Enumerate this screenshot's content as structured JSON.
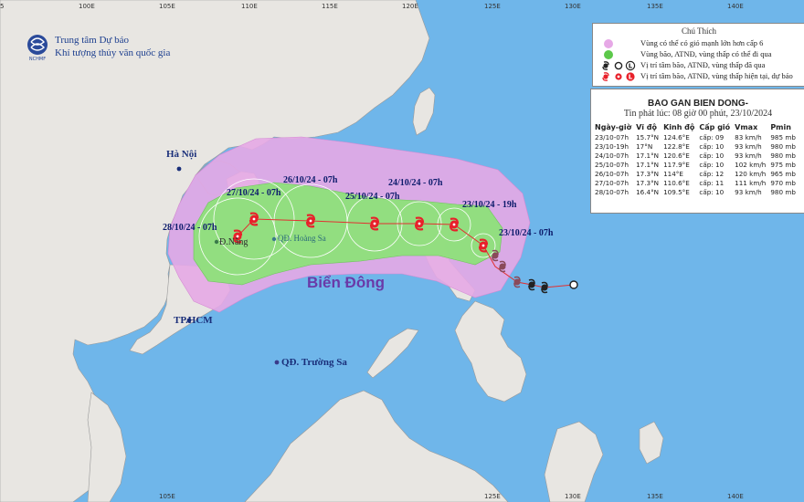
{
  "agency": {
    "line1": "Trung tâm Dự báo",
    "line2": "Khí tượng thủy văn quốc gia",
    "logo_text": "NCHMF"
  },
  "legend": {
    "title": "Chú Thích",
    "items": [
      {
        "symbol": "pink-dot",
        "text": "Vùng có thể có gió mạnh lớn hơn cấp 6"
      },
      {
        "symbol": "green-dot",
        "text": "Vùng bão, ATNĐ, vùng thấp có thể đi qua"
      },
      {
        "symbol": "past-symbols",
        "text": "Vị trí tâm bão, ATNĐ, vùng thấp đã qua",
        "glyph": "L"
      },
      {
        "symbol": "current-symbols",
        "text": "Vị trí tâm bão, ATNĐ, vùng thấp hiện tại, dự báo",
        "glyph": "L"
      }
    ]
  },
  "info": {
    "title": "BAO GAN BIEN DONG-",
    "issued": "Tin phát lúc: 08 giờ 00 phút, 23/10/2024",
    "columns": [
      "Ngày-giờ",
      "Vĩ độ",
      "Kinh độ",
      "Cấp gió",
      "Vmax",
      "Pmin"
    ],
    "rows": [
      [
        "23/10-07h",
        "15.7°N",
        "124.6°E",
        "cấp: 09",
        "83 km/h",
        "985 mb"
      ],
      [
        "23/10-19h",
        "17°N",
        "122.8°E",
        "cấp: 10",
        "93 km/h",
        "980 mb"
      ],
      [
        "24/10-07h",
        "17.1°N",
        "120.6°E",
        "cấp: 10",
        "93 km/h",
        "980 mb"
      ],
      [
        "25/10-07h",
        "17.1°N",
        "117.9°E",
        "cấp: 10",
        "102 km/h",
        "975 mb"
      ],
      [
        "26/10-07h",
        "17.3°N",
        "114°E",
        "cấp: 12",
        "120 km/h",
        "965 mb"
      ],
      [
        "27/10-07h",
        "17.3°N",
        "110.6°E",
        "cấp: 11",
        "111 km/h",
        "970 mb"
      ],
      [
        "28/10-07h",
        "16.4°N",
        "109.5°E",
        "cấp: 10",
        "93 km/h",
        "980 mb"
      ]
    ]
  },
  "map": {
    "sea_name": "Biển Đông",
    "places": {
      "hanoi": "Hà Nội",
      "danang": "Đ.Nẵng",
      "hoangsa": "QĐ. Hoàng Sa",
      "hcm": "TP.HCM",
      "truongsa": "QĐ. Trường Sa"
    },
    "forecast_dates": {
      "d2310_07": "23/10/24 - 07h",
      "d2310_19": "23/10/24 - 19h",
      "d2410": "24/10/24 - 07h",
      "d2510": "25/10/24 - 07h",
      "d2610": "26/10/24 - 07h",
      "d2710": "27/10/24 - 07h",
      "d2810": "28/10/24 - 07h"
    },
    "lon_ticks": [
      "100E",
      "105E",
      "110E",
      "115E",
      "120E",
      "125E",
      "130E",
      "135E",
      "140E"
    ],
    "lat_ticks_left": [
      "5"
    ],
    "colors": {
      "sea": "#6fb6ea",
      "land": "#e8e6e2",
      "pink_zone": "#e6a8e6",
      "green_zone": "#8ee07a",
      "storm": "#e8202a",
      "track": "#e23030"
    }
  }
}
